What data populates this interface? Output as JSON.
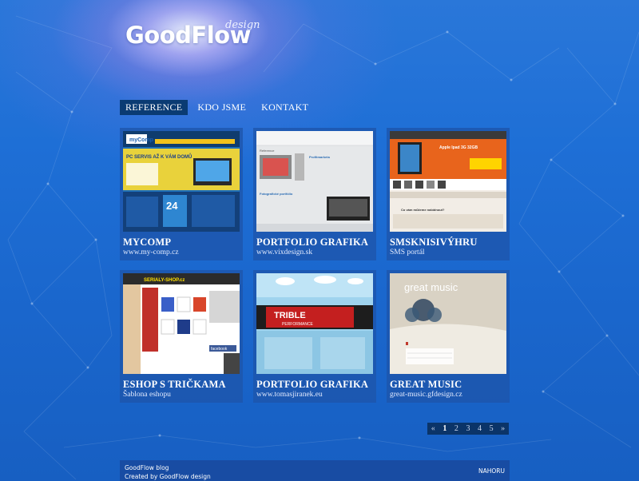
{
  "brand": {
    "logo": "GoodFlow",
    "logo_sub": "design"
  },
  "nav": [
    {
      "label": "REFERENCE",
      "active": true
    },
    {
      "label": "KDO JSME",
      "active": false
    },
    {
      "label": "KONTAKT",
      "active": false
    }
  ],
  "cards": [
    {
      "title": "MYCOMP",
      "subtitle": "www.my-comp.cz",
      "thumb_text": [
        "myComp",
        "PC SERVIS AŽ K VÁM DOMŮ",
        "24"
      ]
    },
    {
      "title": "PORTFOLIO GRAFIKA",
      "subtitle": "www.vixdesign.sk",
      "thumb_text": [
        "Reference",
        "Profitmarketa",
        "Fotografické portfólio"
      ]
    },
    {
      "title": "SMSKNISIVÝHRU",
      "subtitle": "SMS portál",
      "thumb_text": [
        "Apple Ipad 3G 32GB",
        "Co vám můžeme nabídnout?"
      ]
    },
    {
      "title": "ESHOP S TRIČKAMA",
      "subtitle": "Šablona eshopu",
      "thumb_text": [
        "SERIALY-SHOP.cz",
        "facebook"
      ]
    },
    {
      "title": "PORTFOLIO GRAFIKA",
      "subtitle": "www.tomasjiranek.eu",
      "thumb_text": [
        "TRIBLE",
        "PERFORMANCE"
      ]
    },
    {
      "title": "GREAT MUSIC",
      "subtitle": "great-music.gfdesign.cz",
      "thumb_text": [
        "great music"
      ]
    }
  ],
  "pager": {
    "prev": "«",
    "pages": [
      "1",
      "2",
      "3",
      "4",
      "5"
    ],
    "current": "1",
    "next": "»"
  },
  "footer": {
    "line1": "GoodFlow blog",
    "line2": "Created by GoodFlow design",
    "top_link": "NAHORU"
  },
  "colors": {
    "background": "#1e6fd6",
    "nav_active": "#0a3b73",
    "card_bg": "#1e54aa",
    "logo_accent": "#c7e03a"
  }
}
